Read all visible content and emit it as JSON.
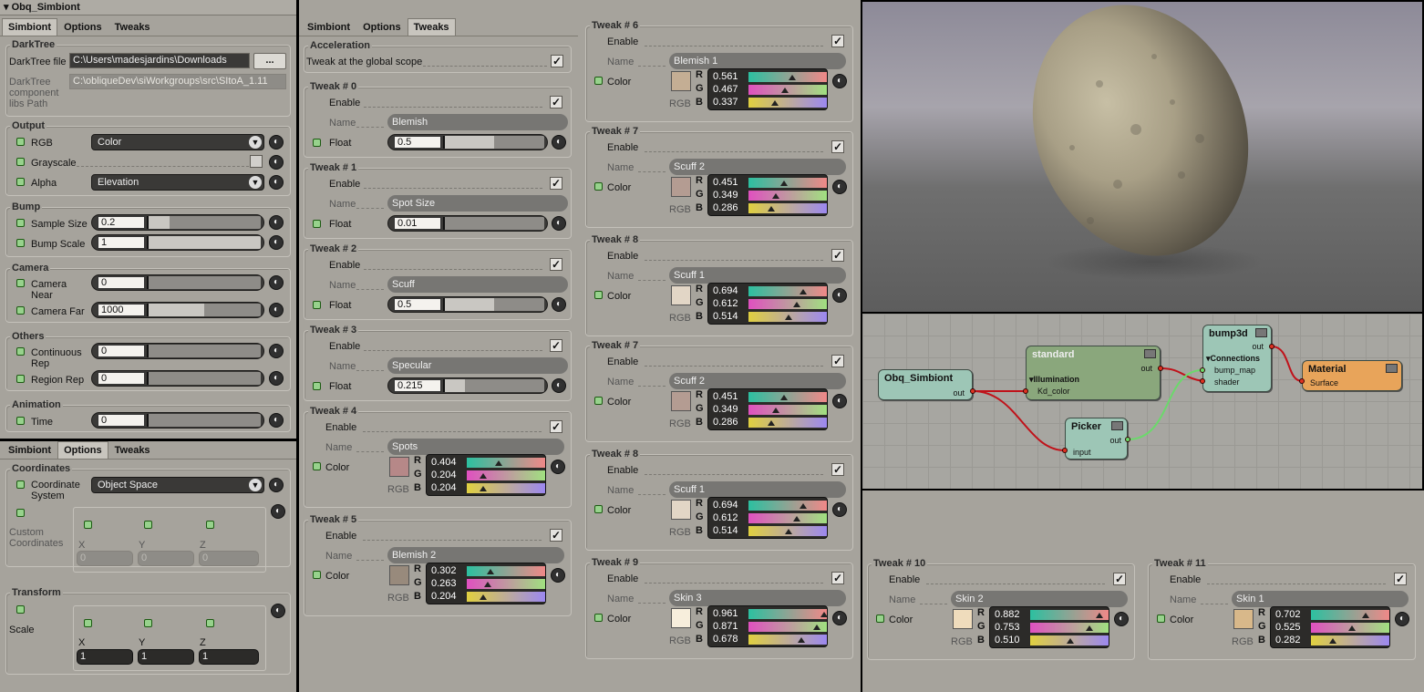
{
  "left_top": {
    "title": "Obq_Simbiont",
    "tabs": [
      "Simbiont",
      "Options",
      "Tweaks"
    ],
    "darktree": {
      "title": "DarkTree",
      "file_label": "DarkTree file",
      "file_value": "C:\\Users\\madesjardins\\Downloads",
      "browse": "...",
      "libs_label": "DarkTree component libs Path",
      "libs_value": "C:\\obliqueDev\\siWorkgroups\\src\\SItoA_1.11"
    },
    "output": {
      "title": "Output",
      "rgb_label": "RGB",
      "rgb_value": "Color",
      "gray_label": "Grayscale",
      "alpha_label": "Alpha",
      "alpha_value": "Elevation"
    },
    "bump": {
      "title": "Bump",
      "sample_label": "Sample Size",
      "sample_value": "0.2",
      "sample_fill": 0.2,
      "scale_label": "Bump Scale",
      "scale_value": "1",
      "scale_fill": 1.0
    },
    "camera": {
      "title": "Camera",
      "near_label": "Camera Near",
      "near_value": "0",
      "near_fill": 0,
      "far_label": "Camera Far",
      "far_value": "1000",
      "far_fill": 0.5
    },
    "others": {
      "title": "Others",
      "cont_label": "Continuous Rep",
      "cont_value": "0",
      "region_label": "Region Rep",
      "region_value": "0"
    },
    "animation": {
      "title": "Animation",
      "time_label": "Time",
      "time_value": "0"
    }
  },
  "left_bottom": {
    "tabs": [
      "Simbiont",
      "Options",
      "Tweaks"
    ],
    "coordinates": {
      "title": "Coordinates",
      "system_label": "Coordinate System",
      "system_value": "Object Space",
      "custom_label": "Custom Coordinates",
      "x_label": "X",
      "y_label": "Y",
      "z_label": "Z",
      "x": "0",
      "y": "0",
      "z": "0"
    },
    "transform": {
      "title": "Transform",
      "scale_label": "Scale",
      "x_label": "X",
      "y_label": "Y",
      "z_label": "Z",
      "x": "1",
      "y": "1",
      "z": "1"
    }
  },
  "middle": {
    "tabs": [
      "Simbiont",
      "Options",
      "Tweaks"
    ],
    "acceleration": {
      "title": "Acceleration",
      "label": "Tweak at the global scope"
    },
    "enable_label": "Enable",
    "name_label": "Name",
    "float_label": "Float",
    "color_label": "Color",
    "rgb_label": "RGB",
    "r": "R",
    "g": "G",
    "b": "B",
    "float_tweaks": [
      {
        "title": "Tweak # 0",
        "name": "Blemish",
        "value": "0.5",
        "fill": 0.5
      },
      {
        "title": "Tweak # 1",
        "name": "Spot Size",
        "value": "0.01",
        "fill": 0.01
      },
      {
        "title": "Tweak # 2",
        "name": "Scuff",
        "value": "0.5",
        "fill": 0.5
      },
      {
        "title": "Tweak # 3",
        "name": "Specular",
        "value": "0.215",
        "fill": 0.215
      }
    ],
    "color_tweaks": [
      {
        "title": "Tweak # 4",
        "name": "Spots",
        "r": "0.404",
        "g": "0.204",
        "b": "0.204",
        "swatch": "#b68888"
      },
      {
        "title": "Tweak # 5",
        "name": "Blemish 2",
        "r": "0.302",
        "g": "0.263",
        "b": "0.204",
        "swatch": "#988a7c"
      }
    ]
  },
  "right_col": {
    "tweaks": [
      {
        "title": "Tweak # 6",
        "name": "Blemish 1",
        "r": "0.561",
        "g": "0.467",
        "b": "0.337",
        "swatch": "#c4ae94"
      },
      {
        "title": "Tweak # 7",
        "name": "Scuff 2",
        "r": "0.451",
        "g": "0.349",
        "b": "0.286",
        "swatch": "#b49c92"
      },
      {
        "title": "Tweak # 8",
        "name": "Scuff 1",
        "r": "0.694",
        "g": "0.612",
        "b": "0.514",
        "swatch": "#e2d6c6"
      },
      {
        "title": "Tweak # 7",
        "name": "Scuff 2",
        "r": "0.451",
        "g": "0.349",
        "b": "0.286",
        "swatch": "#b49c92"
      },
      {
        "title": "Tweak # 8",
        "name": "Scuff 1",
        "r": "0.694",
        "g": "0.612",
        "b": "0.514",
        "swatch": "#e2d6c6"
      },
      {
        "title": "Tweak # 9",
        "name": "Skin 3",
        "r": "0.961",
        "g": "0.871",
        "b": "0.678",
        "swatch": "#f7eedc"
      }
    ]
  },
  "bottom_right": {
    "tweaks": [
      {
        "title": "Tweak # 10",
        "name": "Skin 2",
        "r": "0.882",
        "g": "0.753",
        "b": "0.510",
        "swatch": "#efdcbc"
      },
      {
        "title": "Tweak # 11",
        "name": "Skin 1",
        "r": "0.702",
        "g": "0.525",
        "b": "0.282",
        "swatch": "#d8b88a"
      }
    ]
  },
  "node_graph": {
    "simbiont": {
      "title": "Obq_Simbiont",
      "out": "out"
    },
    "standard": {
      "title": "standard",
      "group": "▾Illumination",
      "port": "Kd_color",
      "out": "out"
    },
    "picker": {
      "title": "Picker",
      "in": "input",
      "out": "out"
    },
    "bump3d": {
      "title": "bump3d",
      "out": "out",
      "group": "▾Connections",
      "p1": "bump_map",
      "p2": "shader"
    },
    "material": {
      "title": "Material",
      "port": "Surface"
    }
  },
  "colors": {
    "panel": "#a6a39c",
    "node_teal": "#9dc6b6",
    "node_green": "#8aa77c",
    "node_orange": "#e8a45a",
    "wire_red": "#c0121a",
    "wire_green": "#6bd96b"
  }
}
